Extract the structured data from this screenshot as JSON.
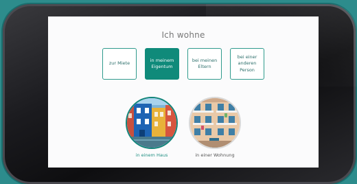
{
  "screen": {
    "heading": "Ich wohne",
    "options": [
      {
        "label": "zur Miete",
        "selected": false
      },
      {
        "label": "in meinem\nEigentum",
        "selected": true
      },
      {
        "label": "bei meinen\nEltern",
        "selected": false
      },
      {
        "label": "bei einer\nanderen\nPerson",
        "selected": false
      }
    ],
    "housing_types": [
      {
        "label": "in einem Haus",
        "selected": true,
        "image": "colorful-houses-photo"
      },
      {
        "label": "in einer Wohnung",
        "selected": false,
        "image": "apartment-building-photo"
      }
    ]
  },
  "colors": {
    "accent": "#0f8a7a",
    "background": "#2d8c8c",
    "screen_bg": "#fbfbfc"
  }
}
